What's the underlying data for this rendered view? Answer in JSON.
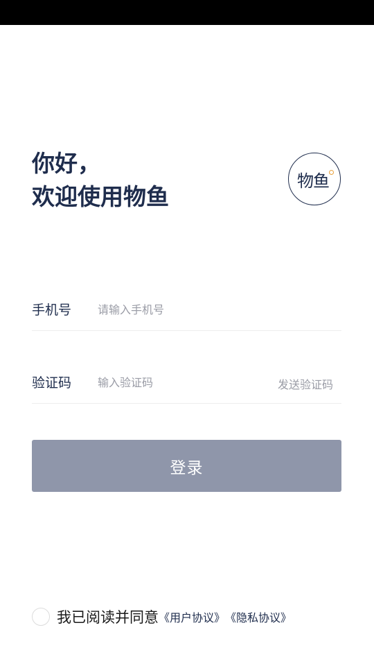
{
  "greeting": {
    "line1": "你好，",
    "line2": "欢迎使用物鱼"
  },
  "logo": {
    "text": "物鱼"
  },
  "phone_field": {
    "label": "手机号",
    "placeholder": "请输入手机号",
    "value": ""
  },
  "code_field": {
    "label": "验证码",
    "placeholder": "输入验证码",
    "value": "",
    "send_label": "发送验证码"
  },
  "login_button": {
    "label": "登录"
  },
  "agreement": {
    "checked": false,
    "text": "我已阅读并同意",
    "user_agreement": "《用户协议》",
    "privacy_policy": "《隐私协议》"
  },
  "colors": {
    "primary_text": "#1f2d4d",
    "button_disabled": "#8f96aa",
    "placeholder": "#9a9ca6",
    "logo_accent": "#e8a03a"
  }
}
